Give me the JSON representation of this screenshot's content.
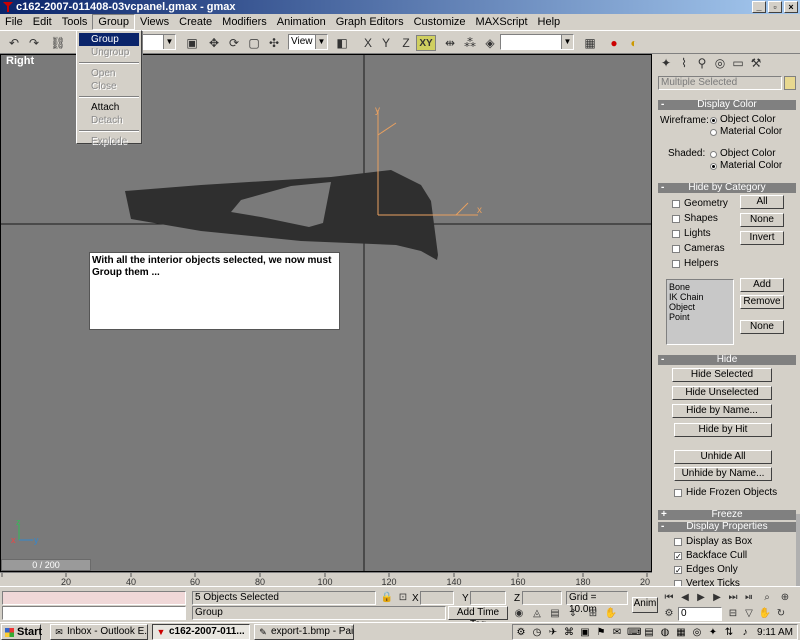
{
  "window": {
    "title": "c162-2007-011408-03vcpanel.gmax - gmax"
  },
  "menubar": {
    "items": [
      "File",
      "Edit",
      "Tools",
      "Group",
      "Views",
      "Create",
      "Modifiers",
      "Animation",
      "Graph Editors",
      "Customize",
      "MAXScript",
      "Help"
    ]
  },
  "group_menu": {
    "items": [
      {
        "label": "Group",
        "state": "highlighted"
      },
      {
        "label": "Ungroup",
        "state": "disabled"
      },
      {
        "label": "Open",
        "state": "disabled"
      },
      {
        "label": "Close",
        "state": "disabled"
      },
      {
        "label": "Attach",
        "state": "enabled"
      },
      {
        "label": "Detach",
        "state": "disabled"
      },
      {
        "label": "Explode",
        "state": "disabled"
      }
    ]
  },
  "toolbar": {
    "view_dropdown": "View",
    "axis_label_x": "X",
    "axis_label_y": "Y",
    "axis_label_z": "Z",
    "axis_label_xy": "XY"
  },
  "viewport": {
    "label": "Right",
    "note": "With all the interior objects selected, we now must Group them ...",
    "gizmo_x": "x",
    "gizmo_y": "y",
    "corner_x": "x",
    "corner_y": "y",
    "corner_z": "z",
    "frame_indicator": "0 / 200"
  },
  "command_panel": {
    "selection_name": "Multiple Selected",
    "display_color": {
      "title": "Display Color",
      "wireframe_label": "Wireframe:",
      "shaded_label": "Shaded:",
      "object_color": "Object Color",
      "material_color": "Material Color"
    },
    "hide_by_category": {
      "title": "Hide by Category",
      "categories": [
        "Geometry",
        "Shapes",
        "Lights",
        "Cameras",
        "Helpers"
      ],
      "all_button": "All",
      "none_button": "None",
      "invert_button": "Invert",
      "list_items": [
        "Bone",
        "IK Chain Object",
        "Point"
      ],
      "add_button": "Add",
      "remove_button": "Remove",
      "list_none_button": "None"
    },
    "hide": {
      "title": "Hide",
      "hide_selected": "Hide Selected",
      "hide_unselected": "Hide Unselected",
      "hide_by_name": "Hide by Name...",
      "hide_by_hit": "Hide by Hit",
      "unhide_all": "Unhide All",
      "unhide_by_name": "Unhide by Name...",
      "hide_frozen": "Hide Frozen Objects"
    },
    "freeze": {
      "title": "Freeze",
      "sign": "+"
    },
    "display_properties": {
      "title": "Display Properties",
      "sign": "-",
      "display_as_box": "Display as Box",
      "backface_cull": "Backface Cull",
      "edges_only": "Edges Only",
      "vertex_ticks": "Vertex Ticks"
    },
    "collapse_sign": "-"
  },
  "time_slider": {
    "ticks": [
      "20",
      "40",
      "60",
      "80",
      "100",
      "120",
      "140",
      "160",
      "180",
      "20"
    ]
  },
  "status": {
    "selection": "5 Objects Selected",
    "prompt": "Group",
    "x_label": "X",
    "y_label": "Y",
    "z_label": "Z",
    "grid": "Grid = 10.0m",
    "add_time_tag": "Add Time Tag",
    "anim": "Anim",
    "frame": "0"
  },
  "taskbar": {
    "start": "Start",
    "tasks": [
      {
        "label": "Inbox - Outlook E...",
        "active": false
      },
      {
        "label": "c162-2007-011...",
        "active": true
      },
      {
        "label": "export-1.bmp - Pai...",
        "active": false
      }
    ],
    "clock": "9:11 AM"
  }
}
